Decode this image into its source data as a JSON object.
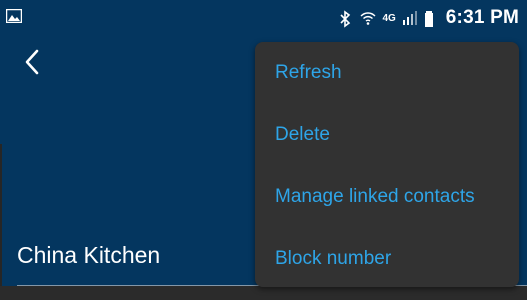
{
  "status_bar": {
    "time": "6:31 PM",
    "network_label": "4G"
  },
  "header": {
    "contact_name": "China Kitchen"
  },
  "overflow_menu": {
    "items": [
      {
        "label": "Refresh"
      },
      {
        "label": "Delete"
      },
      {
        "label": "Manage linked contacts"
      },
      {
        "label": "Block number"
      }
    ]
  },
  "colors": {
    "app_bar": "#04365f",
    "menu_background": "#323232",
    "menu_text": "#2ea5e8",
    "status_text": "#ffffff"
  },
  "icons": {
    "status_left": "image-notification-icon",
    "status_right": [
      "bluetooth-icon",
      "wifi-icon",
      "cellular-signal-icon",
      "battery-icon"
    ],
    "app_bar": "back-arrow-icon"
  }
}
